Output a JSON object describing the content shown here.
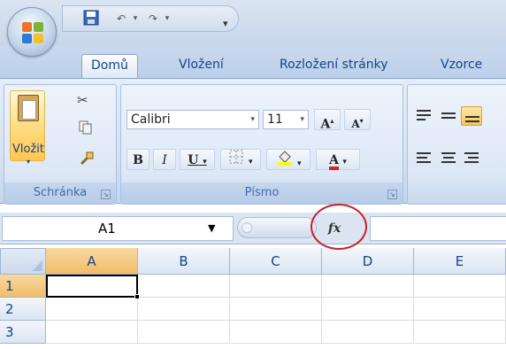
{
  "quick_access": {
    "save_icon": "save-icon",
    "undo_icon": "undo-icon",
    "redo_icon": "redo-icon",
    "customize_icon": "chevron-down-icon"
  },
  "tabs": [
    {
      "label": "Domů",
      "active": true
    },
    {
      "label": "Vložení",
      "active": false
    },
    {
      "label": "Rozložení stránky",
      "active": false
    },
    {
      "label": "Vzorce",
      "active": false
    }
  ],
  "clipboard": {
    "paste_label": "Vložit",
    "group_label": "Schránka"
  },
  "font": {
    "font_name": "Calibri",
    "font_size": "11",
    "grow_label": "A",
    "shrink_label": "A",
    "bold_label": "B",
    "italic_label": "I",
    "underline_label": "U",
    "color_label": "A",
    "group_label": "Písmo"
  },
  "formula_bar": {
    "name_box": "A1",
    "fx_label": "fx",
    "formula": ""
  },
  "sheet": {
    "columns": [
      "A",
      "B",
      "C",
      "D",
      "E"
    ],
    "rows": [
      "1",
      "2",
      "3"
    ],
    "selected_cell": "A1"
  },
  "colors": {
    "ribbon_text": "#15428b",
    "highlight": "#cc1f2a",
    "selected_header": "#f1bd6a"
  }
}
